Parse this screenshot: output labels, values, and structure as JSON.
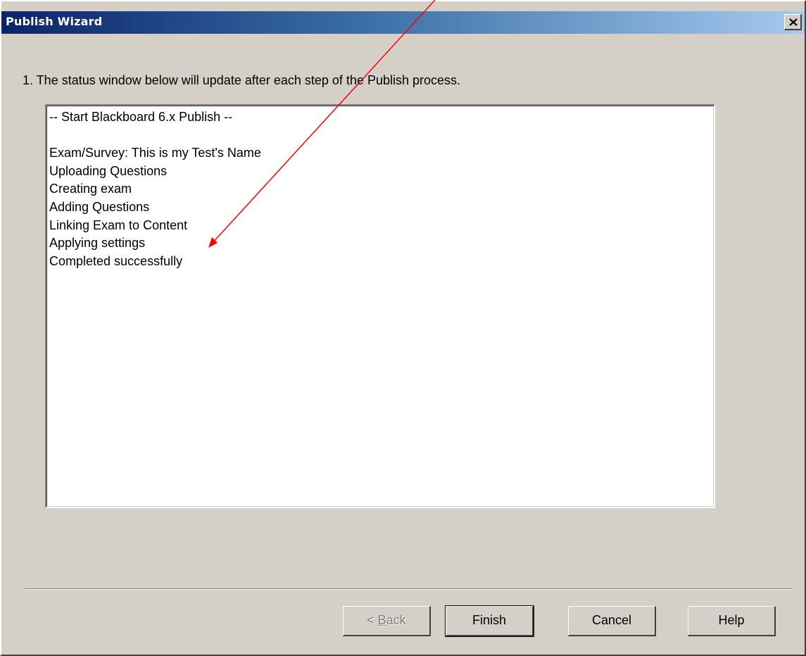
{
  "window": {
    "title": "Publish Wizard"
  },
  "instruction": "1.  The status window below will update after each step of the Publish process.",
  "status": {
    "lines": [
      "-- Start Blackboard 6.x Publish --",
      "",
      "Exam/Survey: This is my Test's Name",
      "Uploading Questions",
      "Creating exam",
      "Adding Questions",
      "Linking Exam to Content",
      "Applying settings",
      "Completed successfully"
    ]
  },
  "buttons": {
    "back_prefix": "< ",
    "back_accel": "B",
    "back_rest": "ack",
    "back_enabled": false,
    "finish_label": "Finish",
    "cancel_label": "Cancel",
    "help_label": "Help"
  },
  "colors": {
    "titlebar_start": "#0a246a",
    "titlebar_end": "#a6caf0",
    "dialog_face": "#d4d0c8",
    "annotation_arrow": "#ff0000"
  },
  "icons": {
    "close": "close-icon"
  }
}
